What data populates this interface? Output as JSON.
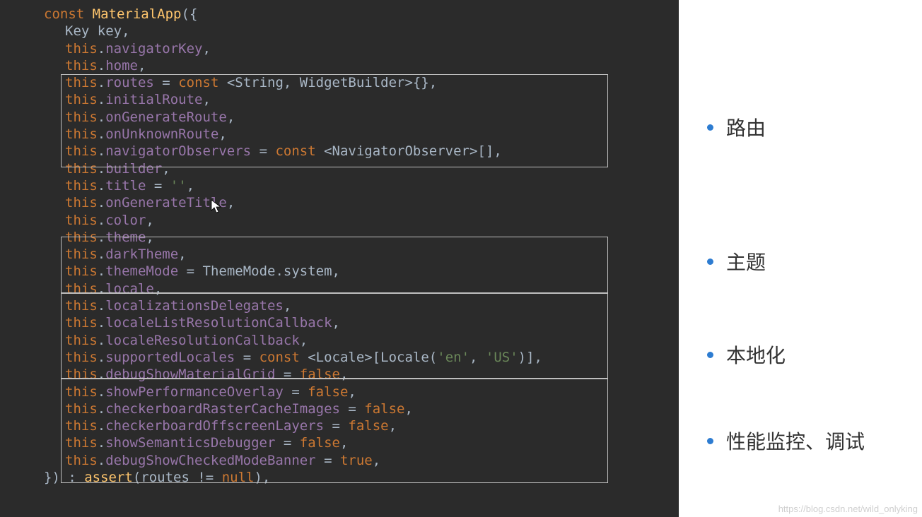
{
  "code": {
    "line1": {
      "kw": "const",
      "cls": "MaterialApp",
      "open": "({"
    },
    "line2": {
      "type": "Key",
      "name": "key",
      "comma": ","
    },
    "line3": {
      "this": "this",
      "dot": ".",
      "prop": "navigatorKey",
      "comma": ","
    },
    "line4": {
      "this": "this",
      "dot": ".",
      "prop": "home",
      "comma": ","
    },
    "line5": {
      "this": "this",
      "dot": ".",
      "prop": "routes",
      "eq": " = ",
      "kw": "const",
      "rest": " <String, WidgetBuilder>{},"
    },
    "line6": {
      "this": "this",
      "dot": ".",
      "prop": "initialRoute",
      "comma": ","
    },
    "line7": {
      "this": "this",
      "dot": ".",
      "prop": "onGenerateRoute",
      "comma": ","
    },
    "line8": {
      "this": "this",
      "dot": ".",
      "prop": "onUnknownRoute",
      "comma": ","
    },
    "line9": {
      "this": "this",
      "dot": ".",
      "prop": "navigatorObservers",
      "eq": " = ",
      "kw": "const",
      "rest": " <NavigatorObserver>[],"
    },
    "line10": {
      "this": "this",
      "dot": ".",
      "prop": "builder",
      "comma": ","
    },
    "line11": {
      "this": "this",
      "dot": ".",
      "prop": "title",
      "eq": " = ",
      "str": "''",
      "comma": ","
    },
    "line12": {
      "this": "this",
      "dot": ".",
      "prop": "onGenerateTitle",
      "comma": ","
    },
    "line13": {
      "this": "this",
      "dot": ".",
      "prop": "color",
      "comma": ","
    },
    "line14": {
      "this": "this",
      "dot": ".",
      "prop": "theme",
      "comma": ","
    },
    "line15": {
      "this": "this",
      "dot": ".",
      "prop": "darkTheme",
      "comma": ","
    },
    "line16": {
      "this": "this",
      "dot": ".",
      "prop": "themeMode",
      "eq": " = ",
      "rest": "ThemeMode.system,"
    },
    "line17": {
      "this": "this",
      "dot": ".",
      "prop": "locale",
      "comma": ","
    },
    "line18": {
      "this": "this",
      "dot": ".",
      "prop": "localizationsDelegates",
      "comma": ","
    },
    "line19": {
      "this": "this",
      "dot": ".",
      "prop": "localeListResolutionCallback",
      "comma": ","
    },
    "line20": {
      "this": "this",
      "dot": ".",
      "prop": "localeResolutionCallback",
      "comma": ","
    },
    "line21": {
      "this": "this",
      "dot": ".",
      "prop": "supportedLocales",
      "eq": " = ",
      "kw": "const",
      "rest1": " <Locale>[Locale(",
      "str1": "'en'",
      "sep": ", ",
      "str2": "'US'",
      "rest2": ")],"
    },
    "line22": {
      "this": "this",
      "dot": ".",
      "prop": "debugShowMaterialGrid",
      "eq": " = ",
      "bool": "false",
      "comma": ","
    },
    "line23": {
      "this": "this",
      "dot": ".",
      "prop": "showPerformanceOverlay",
      "eq": " = ",
      "bool": "false",
      "comma": ","
    },
    "line24": {
      "this": "this",
      "dot": ".",
      "prop": "checkerboardRasterCacheImages",
      "eq": " = ",
      "bool": "false",
      "comma": ","
    },
    "line25": {
      "this": "this",
      "dot": ".",
      "prop": "checkerboardOffscreenLayers",
      "eq": " = ",
      "bool": "false",
      "comma": ","
    },
    "line26": {
      "this": "this",
      "dot": ".",
      "prop": "showSemanticsDebugger",
      "eq": " = ",
      "bool": "false",
      "comma": ","
    },
    "line27": {
      "this": "this",
      "dot": ".",
      "prop": "debugShowCheckedModeBanner",
      "eq": " = ",
      "bool": "true",
      "comma": ","
    },
    "line28": {
      "close": "}) : ",
      "assert": "assert",
      "rest": "(routes != ",
      "null": "null",
      "end": "),"
    }
  },
  "annotations": {
    "a1": "路由",
    "a2": "主题",
    "a3": "本地化",
    "a4": "性能监控、调试"
  },
  "watermark": "https://blog.csdn.net/wild_onlyking"
}
